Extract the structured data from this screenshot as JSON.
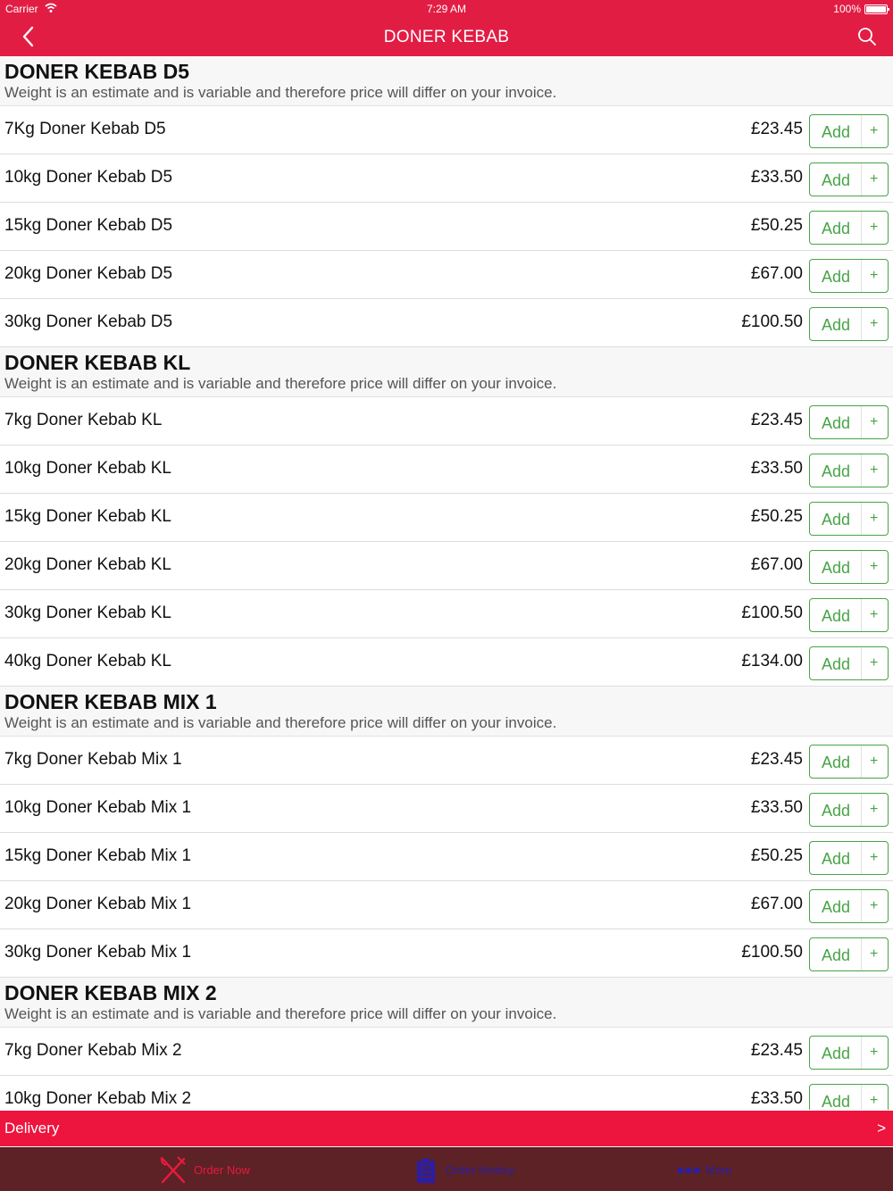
{
  "status_bar": {
    "carrier": "Carrier",
    "time": "7:29 AM",
    "battery": "100%"
  },
  "nav": {
    "title": "DONER KEBAB"
  },
  "add_label": "Add",
  "plus_label": "+",
  "sections": [
    {
      "title": "DONER KEBAB D5",
      "note": "Weight is an estimate and is variable and therefore price will differ on your invoice.",
      "items": [
        {
          "name": "7Kg Doner Kebab D5",
          "price": "£23.45"
        },
        {
          "name": "10kg Doner Kebab D5",
          "price": "£33.50"
        },
        {
          "name": "15kg Doner Kebab D5",
          "price": "£50.25"
        },
        {
          "name": "20kg Doner Kebab D5",
          "price": "£67.00"
        },
        {
          "name": "30kg Doner Kebab D5",
          "price": "£100.50"
        }
      ]
    },
    {
      "title": "DONER KEBAB KL",
      "note": "Weight is an estimate and is variable and therefore price will differ on your invoice.",
      "items": [
        {
          "name": "7kg Doner Kebab KL",
          "price": "£23.45"
        },
        {
          "name": "10kg Doner Kebab KL",
          "price": "£33.50"
        },
        {
          "name": "15kg Doner Kebab KL",
          "price": "£50.25"
        },
        {
          "name": "20kg Doner Kebab KL",
          "price": "£67.00"
        },
        {
          "name": "30kg Doner Kebab KL",
          "price": "£100.50"
        },
        {
          "name": "40kg Doner Kebab KL",
          "price": "£134.00"
        }
      ]
    },
    {
      "title": "DONER KEBAB MIX 1",
      "note": "Weight is an estimate and is variable and therefore price will differ on your invoice.",
      "items": [
        {
          "name": "7kg Doner Kebab Mix 1",
          "price": "£23.45"
        },
        {
          "name": "10kg Doner Kebab Mix 1",
          "price": "£33.50"
        },
        {
          "name": "15kg Doner Kebab Mix 1",
          "price": "£50.25"
        },
        {
          "name": "20kg Doner Kebab Mix 1",
          "price": "£67.00"
        },
        {
          "name": "30kg Doner Kebab Mix 1",
          "price": "£100.50"
        }
      ]
    },
    {
      "title": "DONER KEBAB MIX 2",
      "note": "Weight is an estimate and is variable and therefore price will differ on your invoice.",
      "items": [
        {
          "name": "7kg Doner Kebab Mix 2",
          "price": "£23.45"
        },
        {
          "name": "10kg Doner Kebab Mix 2",
          "price": "£33.50"
        }
      ]
    }
  ],
  "delivery": {
    "label": "Delivery",
    "arrow": ">"
  },
  "tabs": [
    {
      "label": "Order Now",
      "icon": "fork-knife-icon",
      "color": "#e8193d"
    },
    {
      "label": "Order History",
      "icon": "clipboard-icon",
      "color": "#2b1ea6"
    },
    {
      "label": "More",
      "icon": "more-dots-icon",
      "color": "#2b1ea6"
    }
  ],
  "colors": {
    "brand": "#e21d44",
    "add_green": "#47a447",
    "tab_bar": "#5c2225"
  }
}
